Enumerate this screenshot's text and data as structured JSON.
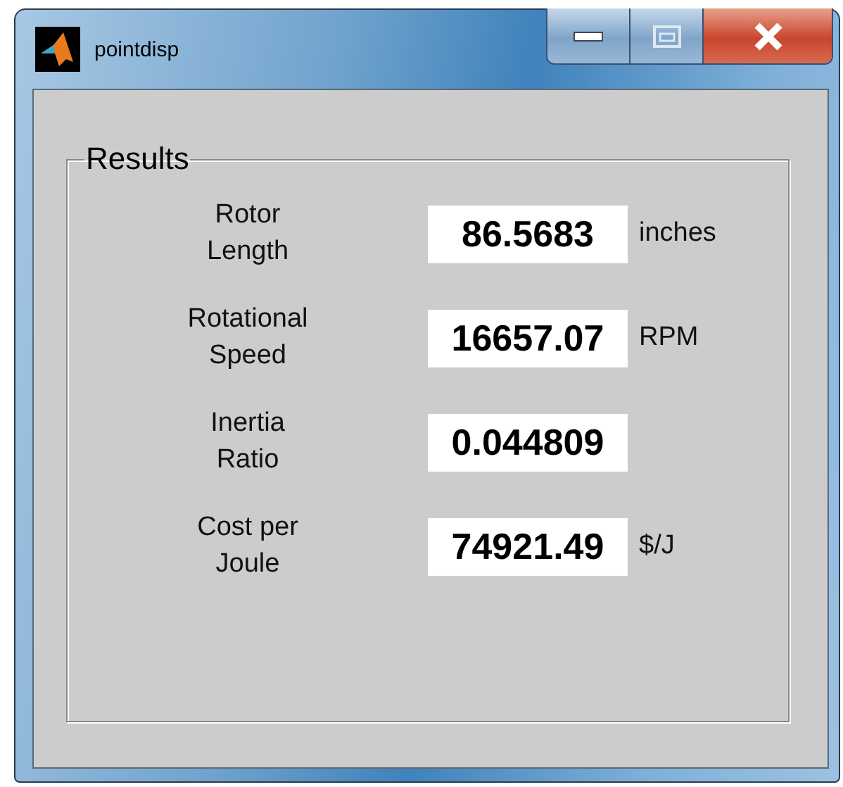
{
  "window": {
    "title": "pointdisp"
  },
  "panel": {
    "title": "Results"
  },
  "results": [
    {
      "label": "Rotor\nLength",
      "value": "86.5683",
      "unit": "inches"
    },
    {
      "label": "Rotational\nSpeed",
      "value": "16657.07",
      "unit": "RPM"
    },
    {
      "label": "Inertia\nRatio",
      "value": "0.044809"
    },
    {
      "label": "Cost per\nJoule",
      "value": "74921.49",
      "unit": "$/J"
    }
  ]
}
